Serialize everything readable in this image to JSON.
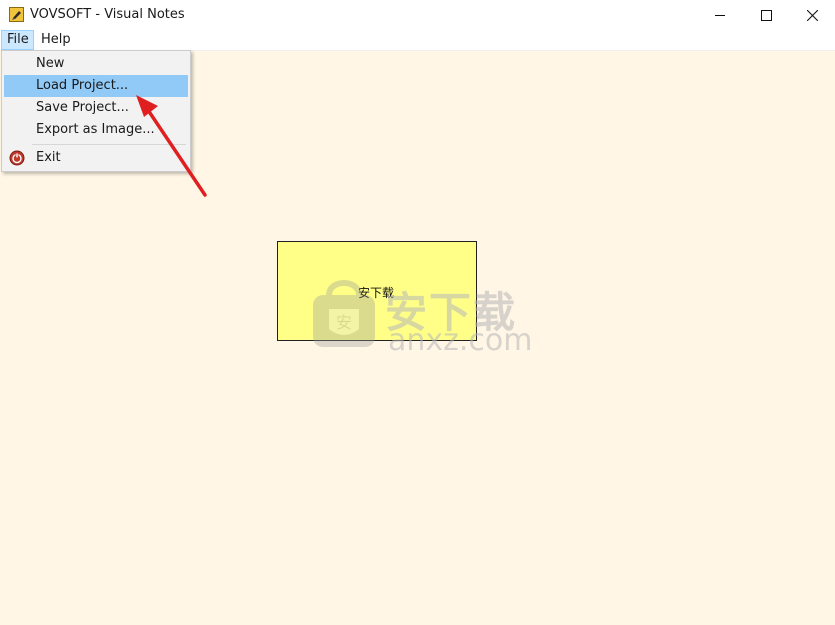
{
  "window": {
    "title": "VOVSOFT - Visual Notes"
  },
  "menubar": {
    "file": "File",
    "help": "Help"
  },
  "file_menu": {
    "items": [
      {
        "label": "New"
      },
      {
        "label": "Load Project..."
      },
      {
        "label": "Save Project..."
      },
      {
        "label": "Export as Image..."
      },
      {
        "label": "Exit",
        "icon": "power-icon"
      }
    ],
    "highlighted": "Load Project..."
  },
  "canvas": {
    "background": "#fff6e5",
    "note": {
      "text": "安下载",
      "color": "#ffff88"
    }
  },
  "watermark": {
    "title": "安下载",
    "subtitle": "anxz.com",
    "shield_glyph": "安"
  },
  "colors": {
    "menu_highlight": "#91c9f7",
    "annotation_arrow": "#e02020"
  }
}
